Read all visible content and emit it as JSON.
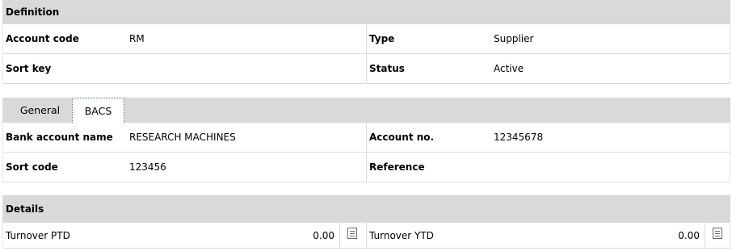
{
  "definition": {
    "header": "Definition",
    "account_code_label": "Account code",
    "account_code_value": "RM",
    "type_label": "Type",
    "type_value": "Supplier",
    "sort_key_label": "Sort key",
    "sort_key_value": "",
    "status_label": "Status",
    "status_value": "Active"
  },
  "tabs": [
    {
      "label": "General",
      "active": false
    },
    {
      "label": "BACS",
      "active": true
    }
  ],
  "bacs": {
    "bank_account_name_label": "Bank account name",
    "bank_account_name_value": "RESEARCH MACHINES",
    "account_no_label": "Account no.",
    "account_no_value": "12345678",
    "sort_code_label": "Sort code",
    "sort_code_value": "123456",
    "reference_label": "Reference",
    "reference_value": ""
  },
  "details": {
    "header": "Details",
    "turnover_ptd_label": "Turnover PTD",
    "turnover_ptd_value": "0.00",
    "turnover_ytd_label": "Turnover YTD",
    "turnover_ytd_value": "0.00"
  },
  "icons": {
    "drilldown": "document-icon"
  }
}
